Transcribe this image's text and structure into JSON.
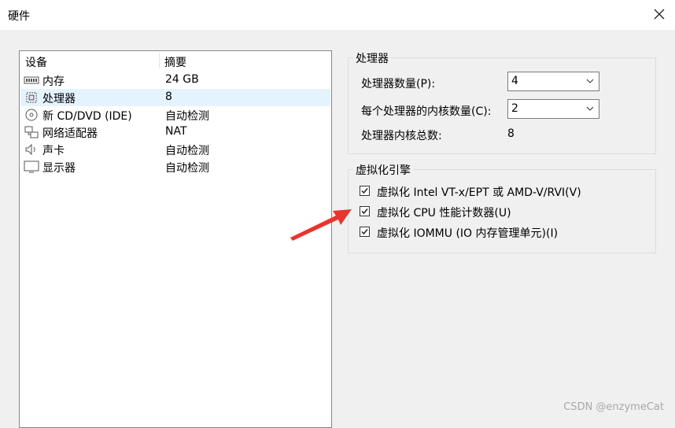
{
  "window": {
    "title": "硬件",
    "close_icon": "close-icon"
  },
  "device_list": {
    "header_device": "设备",
    "header_summary": "摘要",
    "rows": [
      {
        "name": "内存",
        "summary": "24 GB",
        "icon": "memory-icon"
      },
      {
        "name": "处理器",
        "summary": "8",
        "icon": "processor-icon",
        "selected": true
      },
      {
        "name": "新 CD/DVD (IDE)",
        "summary": "自动检测",
        "icon": "cd-dvd-icon"
      },
      {
        "name": "网络适配器",
        "summary": "NAT",
        "icon": "network-icon"
      },
      {
        "name": "声卡",
        "summary": "自动检测",
        "icon": "speaker-icon"
      },
      {
        "name": "显示器",
        "summary": "自动检测",
        "icon": "monitor-icon"
      }
    ]
  },
  "processors": {
    "legend": "处理器",
    "count_label": "处理器数量(P):",
    "count_value": "4",
    "cores_label": "每个处理器的内核数量(C):",
    "cores_value": "2",
    "total_label": "处理器内核总数:",
    "total_value": "8"
  },
  "virtualization": {
    "legend": "虚拟化引擎",
    "options": [
      {
        "label": "虚拟化 Intel VT-x/EPT 或 AMD-V/RVI(V)",
        "checked": true
      },
      {
        "label": "虚拟化 CPU 性能计数器(U)",
        "checked": true
      },
      {
        "label": "虚拟化 IOMMU (IO 内存管理单元)(I)",
        "checked": true
      }
    ]
  },
  "annotation": {
    "color": "#e8352e"
  },
  "watermark": "CSDN @enzymeCat"
}
